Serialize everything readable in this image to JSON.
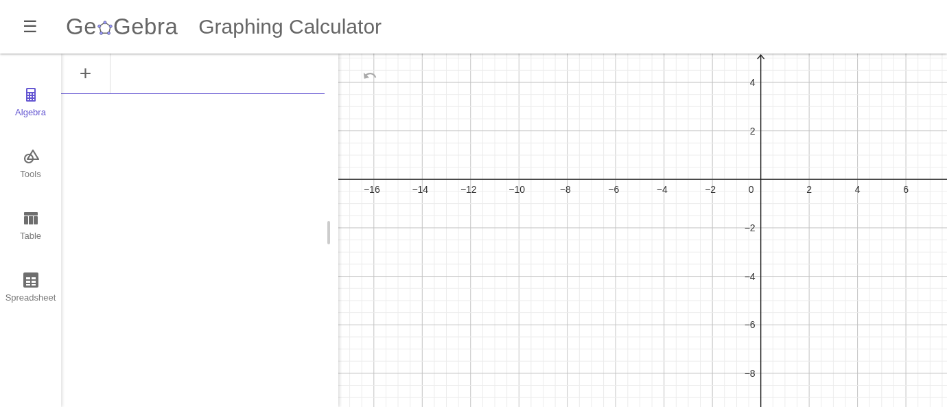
{
  "header": {
    "menu": "☰",
    "logo": {
      "left": "Ge",
      "right": "Gebra"
    },
    "title": "Graphing Calculator"
  },
  "sidebar": {
    "items": [
      {
        "label": "Algebra",
        "kind": "calculator",
        "selected": true
      },
      {
        "label": "Tools",
        "kind": "shapes",
        "selected": false
      },
      {
        "label": "Table",
        "kind": "table",
        "selected": false
      },
      {
        "label": "Spreadsheet",
        "kind": "spreadsheet",
        "selected": false
      }
    ]
  },
  "algebra": {
    "add_button": "+"
  },
  "graph": {
    "chart_data": {
      "type": "line",
      "grid": true,
      "xlim": [
        -17.47,
        7.7
      ],
      "ylim": [
        -9.39,
        5.19
      ],
      "xticks": [
        {
          "value": -16,
          "label": "−16"
        },
        {
          "value": -14,
          "label": "−14"
        },
        {
          "value": -12,
          "label": "−12"
        },
        {
          "value": -10,
          "label": "−10"
        },
        {
          "value": -8,
          "label": "−8"
        },
        {
          "value": -6,
          "label": "−6"
        },
        {
          "value": -4,
          "label": "−4"
        },
        {
          "value": -2,
          "label": "−2"
        },
        {
          "value": 2,
          "label": "2"
        },
        {
          "value": 4,
          "label": "4"
        },
        {
          "value": 6,
          "label": "6"
        }
      ],
      "yticks": [
        {
          "value": 4,
          "label": "4"
        },
        {
          "value": 2,
          "label": "2"
        },
        {
          "value": -2,
          "label": "−2"
        },
        {
          "value": -4,
          "label": "−4"
        },
        {
          "value": -6,
          "label": "−6"
        },
        {
          "value": -8,
          "label": "−8"
        }
      ]
    },
    "origin_label": "0"
  }
}
